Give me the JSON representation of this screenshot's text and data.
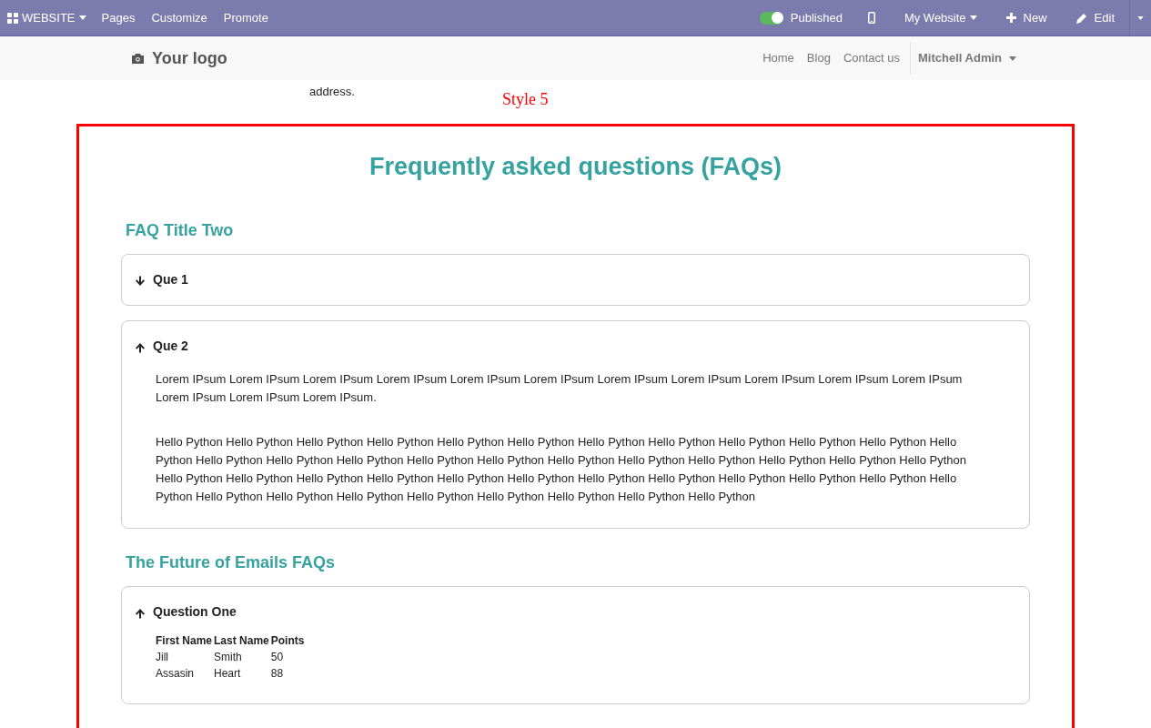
{
  "admin_bar": {
    "app_menu": "WEBSITE",
    "menu": [
      "Pages",
      "Customize",
      "Promote"
    ],
    "published": {
      "label": "Published",
      "on": true
    },
    "website": "My Website",
    "new": "New",
    "edit": "Edit"
  },
  "header": {
    "logo": "Your logo",
    "nav": [
      "Home",
      "Blog",
      "Contact us"
    ],
    "user": "Mitchell Admin"
  },
  "above": {
    "text": "address.",
    "style_label": "Style 5"
  },
  "faq": {
    "title": "Frequently asked questions (FAQs)",
    "sections": [
      {
        "title": "FAQ Title Two",
        "items": [
          {
            "question": "Que 1",
            "expanded": false
          },
          {
            "question": "Que 2",
            "expanded": true,
            "kind": "text",
            "paragraphs": [
              "Lorem IPsum Lorem IPsum Lorem IPsum Lorem IPsum Lorem IPsum Lorem IPsum Lorem IPsum Lorem IPsum Lorem IPsum Lorem IPsum Lorem IPsum Lorem IPsum Lorem IPsum Lorem IPsum.",
              "Hello Python Hello Python Hello Python Hello Python Hello Python Hello Python Hello Python Hello Python Hello Python Hello Python Hello Python Hello Python Hello Python Hello Python Hello Python Hello Python Hello Python Hello Python Hello Python Hello Python Hello Python Hello Python Hello Python Hello Python Hello Python Hello Python Hello Python Hello Python Hello Python Hello Python Hello Python Hello Python Hello Python Hello Python Hello Python Hello Python Hello Python Hello Python Hello Python Hello Python Hello Python Hello Python Hello Python"
            ]
          }
        ]
      },
      {
        "title": "The Future of Emails FAQs",
        "items": [
          {
            "question": "Question One",
            "expanded": true,
            "kind": "table",
            "table": {
              "columns": [
                "First Name",
                "Last Name",
                "Points"
              ],
              "rows": [
                [
                  "Jill",
                  "Smith",
                  "50"
                ],
                [
                  "Assasin",
                  "Heart",
                  "88"
                ]
              ]
            }
          }
        ]
      }
    ]
  }
}
